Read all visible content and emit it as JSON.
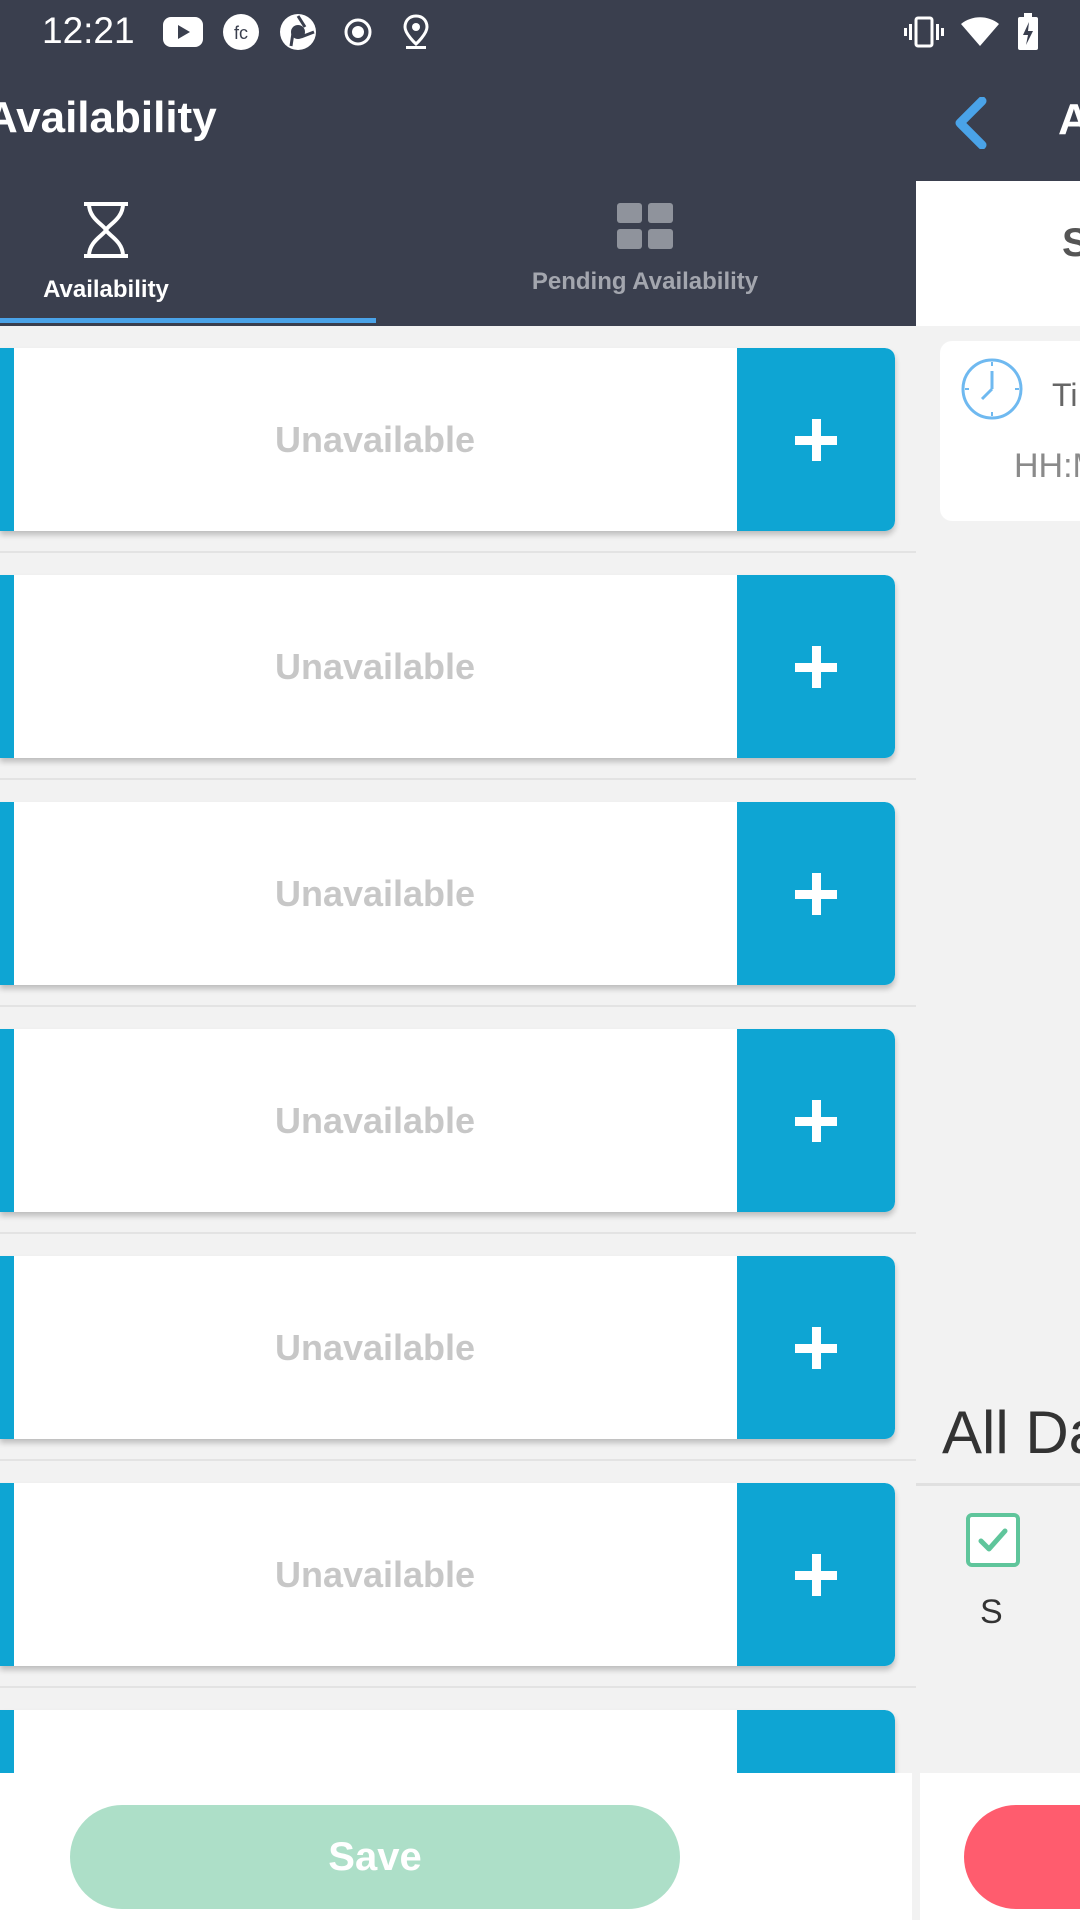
{
  "status_bar": {
    "time": "12:21",
    "left_icons": [
      "youtube-icon",
      "fc-app-icon",
      "shutter-app-icon",
      "record-icon",
      "location-icon"
    ],
    "right_icons": [
      "vibrate-icon",
      "wifi-icon",
      "battery-charging-icon"
    ]
  },
  "left_panel": {
    "title": "Availability",
    "tabs": [
      {
        "label": "Availability",
        "icon": "hourglass-icon",
        "active": true
      },
      {
        "label": "Pending Availability",
        "icon": "grid-icon",
        "active": false
      }
    ],
    "slots": [
      {
        "label": "Unavailable"
      },
      {
        "label": "Unavailable"
      },
      {
        "label": "Unavailable"
      },
      {
        "label": "Unavailable"
      },
      {
        "label": "Unavailable"
      },
      {
        "label": "Unavailable"
      },
      {
        "label": ""
      }
    ],
    "save_label": "Save"
  },
  "right_panel": {
    "title": "A",
    "header": "S",
    "time_label": "Ti",
    "time_placeholder": "HH:M",
    "all_day_label": "All Da",
    "day_letter": "S"
  },
  "colors": {
    "header_bg": "#3a3f4e",
    "accent_blue": "#0ea5d3",
    "tab_underline": "#4aa3e8",
    "save_green": "#addfc8",
    "check_green": "#5fc59b",
    "danger_red": "#ff5c6e"
  }
}
